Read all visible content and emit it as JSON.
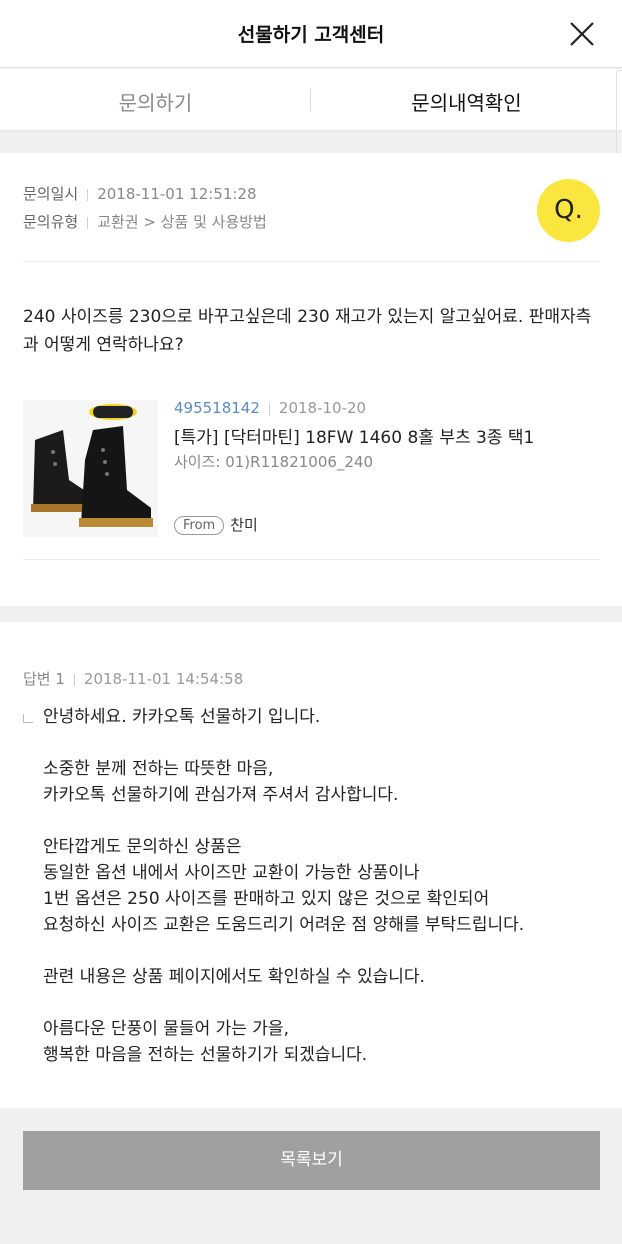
{
  "header": {
    "title": "선물하기 고객센터",
    "close_icon": "close-icon"
  },
  "tabs": [
    {
      "label": "문의하기"
    },
    {
      "label": "문의내역확인"
    }
  ],
  "inquiry": {
    "date_label": "문의일시",
    "date_value": "2018-11-01 12:51:28",
    "type_label": "문의유형",
    "type_value": "교환권 > 상품 및 사용방법",
    "badge": "Q.",
    "badge_color": "#fae63e",
    "question": "240 사이즈릉 230으로 바꾸고싶은데 230 재고가 있는지 알고싶어료. 판매자측과 어떻게 연락하나요?"
  },
  "product": {
    "image_icon": "boots-image",
    "order_number": "495518142",
    "order_date": "2018-10-20",
    "name": "[특가] [닥터마틴] 18FW 1460 8홀 부츠 3종 택1",
    "option": "사이즈: 01)R11821006_240",
    "from_label": "From",
    "from_name": "찬미"
  },
  "answer": {
    "label": "답변 1",
    "date": "2018-11-01 14:54:58",
    "body": "안녕하세요. 카카오톡 선물하기 입니다.\n\n소중한 분께 전하는 따뜻한 마음,\n카카오톡 선물하기에 관심가져 주셔서 감사합니다.\n\n안타깝게도 문의하신 상품은\n동일한 옵션 내에서 사이즈만 교환이 가능한 상품이나\n1번 옵션은 250 사이즈를 판매하고 있지 않은 것으로 확인되어\n요청하신 사이즈 교환은 도움드리기 어려운 점 양해를 부탁드립니다.\n\n관련 내용은 상품 페이지에서도 확인하실 수 있습니다.\n\n아름다운 단풍이 물들어 가는 가을,\n행복한 마음을 전하는 선물하기가 되겠습니다."
  },
  "footer": {
    "list_button": "목록보기"
  }
}
